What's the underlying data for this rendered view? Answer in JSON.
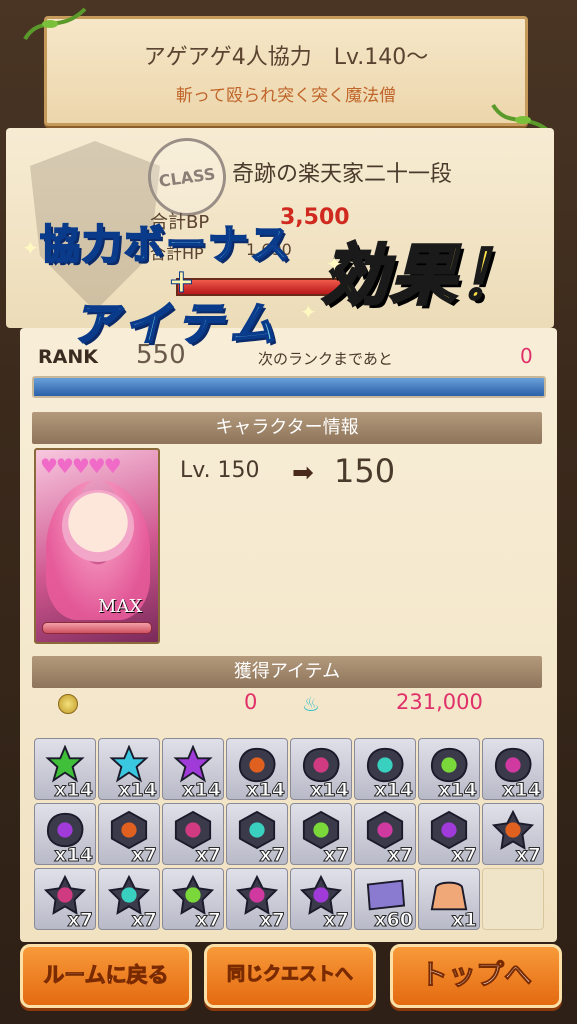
{
  "quest": {
    "title": "アゲアゲ4人協力　Lv.140～",
    "subtitle": "斬って殴られ突く突く魔法僧"
  },
  "class_info": {
    "stamp": "CLASS",
    "name": "奇跡の楽天家二十一段",
    "bp_label": "合計BP",
    "bp_value": "3,500",
    "hp_label": "合計HP",
    "hp_value": "1,690"
  },
  "banner": {
    "line1": "協力ボーナス",
    "plus": "+",
    "line2": "アイテム",
    "effect": "効果！"
  },
  "rank": {
    "label": "RANK",
    "value": "550",
    "next_label": "次のランクまであと",
    "next_value": "0",
    "progress": 1.0
  },
  "character": {
    "section_title": "キャラクター情報",
    "hearts": "♥♥♥♥♥",
    "max_label": "MAX",
    "level_from": "Lv. 150",
    "level_to": "150"
  },
  "items": {
    "section_title": "獲得アイテム",
    "coin_value": "0",
    "soul_value": "231,000",
    "slots": [
      {
        "color": "#3fbf3a",
        "shape": "star",
        "qty": "x14"
      },
      {
        "color": "#3ac8e0",
        "shape": "star",
        "qty": "x14"
      },
      {
        "color": "#a03ad8",
        "shape": "star",
        "qty": "x14"
      },
      {
        "color": "#e06020",
        "shape": "stone",
        "qty": "x14"
      },
      {
        "color": "#d03a80",
        "shape": "stone",
        "qty": "x14"
      },
      {
        "color": "#3ad0c0",
        "shape": "stone",
        "qty": "x14"
      },
      {
        "color": "#7ad83a",
        "shape": "stone",
        "qty": "x14"
      },
      {
        "color": "#d03aa0",
        "shape": "stone",
        "qty": "x14"
      },
      {
        "color": "#a03ad8",
        "shape": "stone",
        "qty": "x14"
      },
      {
        "color": "#e06020",
        "shape": "hex",
        "qty": "x7"
      },
      {
        "color": "#d03a80",
        "shape": "hex",
        "qty": "x7"
      },
      {
        "color": "#3ad0c0",
        "shape": "hex",
        "qty": "x7"
      },
      {
        "color": "#7ad83a",
        "shape": "hex",
        "qty": "x7"
      },
      {
        "color": "#d03aa0",
        "shape": "hex",
        "qty": "x7"
      },
      {
        "color": "#a03ad8",
        "shape": "hex",
        "qty": "x7"
      },
      {
        "color": "#e06020",
        "shape": "dstar",
        "qty": "x7"
      },
      {
        "color": "#d03a80",
        "shape": "dstar",
        "qty": "x7"
      },
      {
        "color": "#3ad0c0",
        "shape": "dstar",
        "qty": "x7"
      },
      {
        "color": "#7ad83a",
        "shape": "dstar",
        "qty": "x7"
      },
      {
        "color": "#d03aa0",
        "shape": "dstar",
        "qty": "x7"
      },
      {
        "color": "#a03ad8",
        "shape": "dstar",
        "qty": "x7"
      },
      {
        "color": "#8a7ad0",
        "shape": "ticket",
        "qty": "x60"
      },
      {
        "color": "#f0a878",
        "shape": "bag",
        "qty": "x1"
      },
      {
        "color": "",
        "shape": "empty",
        "qty": ""
      }
    ]
  },
  "buttons": {
    "room": "ルームに戻る",
    "same_quest": "同じクエストへ",
    "top": "トップへ"
  },
  "colors": {
    "accent_orange": "#e46a10",
    "value_pink": "#e0306a",
    "bp_red": "#d02a20"
  }
}
